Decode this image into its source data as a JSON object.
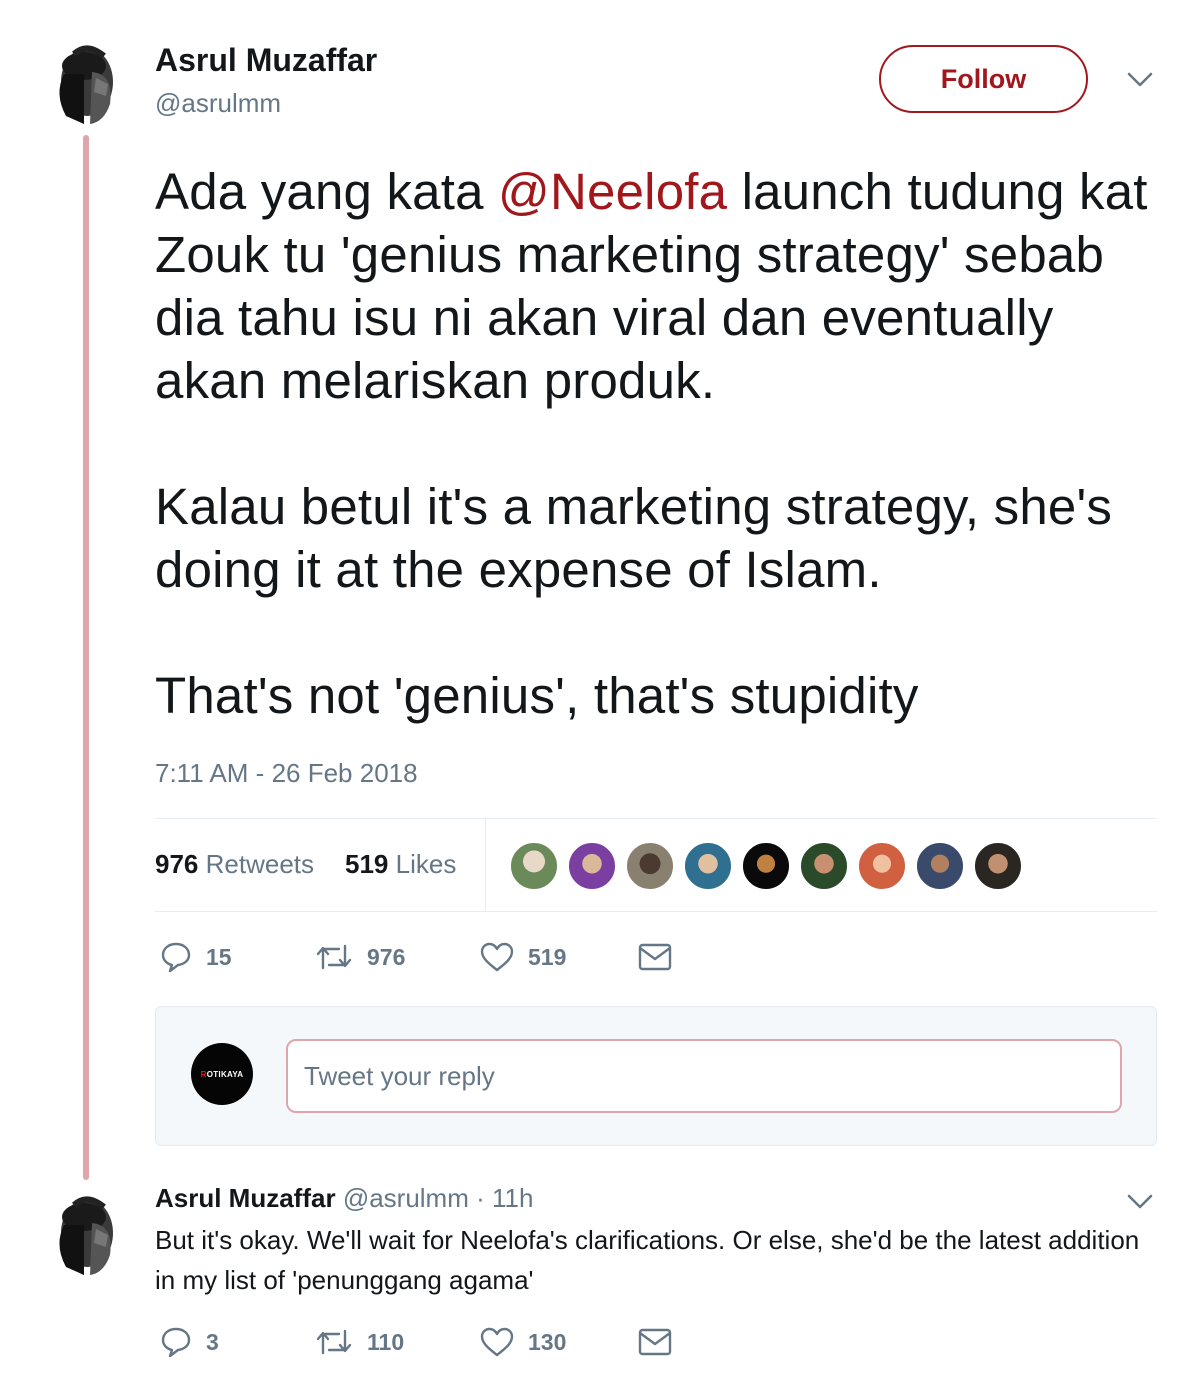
{
  "tweet": {
    "author_name": "Asrul Muzaffar",
    "author_handle": "@asrulmm",
    "follow_label": "Follow",
    "text_p1_before": "Ada yang kata ",
    "mention": "@Neelofa",
    "text_p1_after": " launch tudung kat Zouk tu 'genius marketing strategy' sebab dia tahu isu ni akan viral dan eventually akan melariskan produk.",
    "text_p2": "Kalau betul it's a marketing strategy, she's doing it at the expense of Islam.",
    "text_p3": "That's not 'genius', that's stupidity",
    "timestamp": "7:11 AM - 26 Feb 2018",
    "retweets_count": "976",
    "retweets_label": "Retweets",
    "likes_count": "519",
    "likes_label": "Likes",
    "actions": {
      "reply_count": "15",
      "retweet_count": "976",
      "like_count": "519"
    }
  },
  "reply_box": {
    "placeholder": "Tweet your reply",
    "avatar_text_r": "R",
    "avatar_text_rest": "OTIKAYA"
  },
  "reply_tweet": {
    "author_name": "Asrul Muzaffar",
    "author_handle": "@asrulmm",
    "time": " · 11h",
    "text": "But it's okay. We'll wait for Neelofa's clarifications. Or else, she'd be the latest addition in my list of 'penunggang agama'",
    "actions": {
      "reply_count": "3",
      "retweet_count": "110",
      "like_count": "130"
    }
  },
  "colors": {
    "accent": "#a0181c",
    "thread_line": "#e0a5ab",
    "muted": "#657786",
    "text": "#14171a"
  },
  "icons": [
    "reply-icon",
    "retweet-icon",
    "heart-icon",
    "mail-icon",
    "chevron-down-icon"
  ]
}
